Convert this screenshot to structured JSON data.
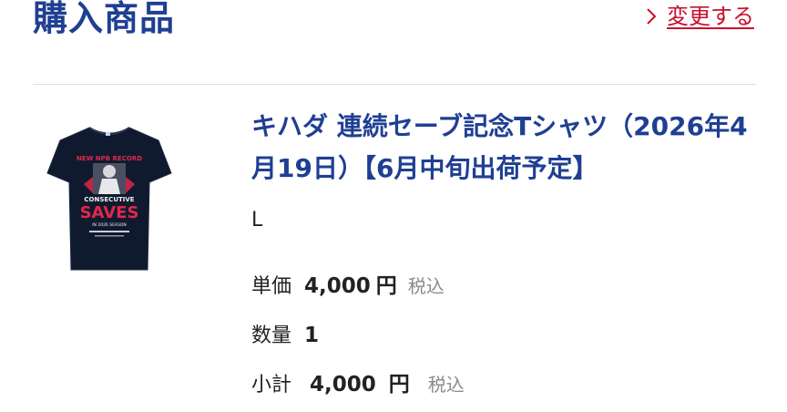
{
  "section": {
    "title": "購入商品",
    "change_label": "変更する"
  },
  "product": {
    "name": "キハダ 連続セーブ記念Tシャツ（2026年4月19日）【6月中旬出荷予定】",
    "variant": "L",
    "image": {
      "text_top": "NEW NPB RECORD",
      "text_mid": "CONSECUTIVE",
      "text_big": "SAVES",
      "text_sub": "IN 2026 SEASON",
      "shirt_color": "#101a2e",
      "accent_color": "#e0284a"
    },
    "unit_price": {
      "label": "単価",
      "value": "4,000",
      "unit": "円",
      "tax": "税込"
    },
    "quantity": {
      "label": "数量",
      "value": "1"
    },
    "subtotal": {
      "label": "小計",
      "value": "4,000",
      "unit": "円",
      "tax": "税込"
    }
  },
  "colors": {
    "title_blue": "#1f3f93",
    "link_red": "#c8102e",
    "muted_gray": "#8a8a8a",
    "divider": "#dcdcdc"
  }
}
